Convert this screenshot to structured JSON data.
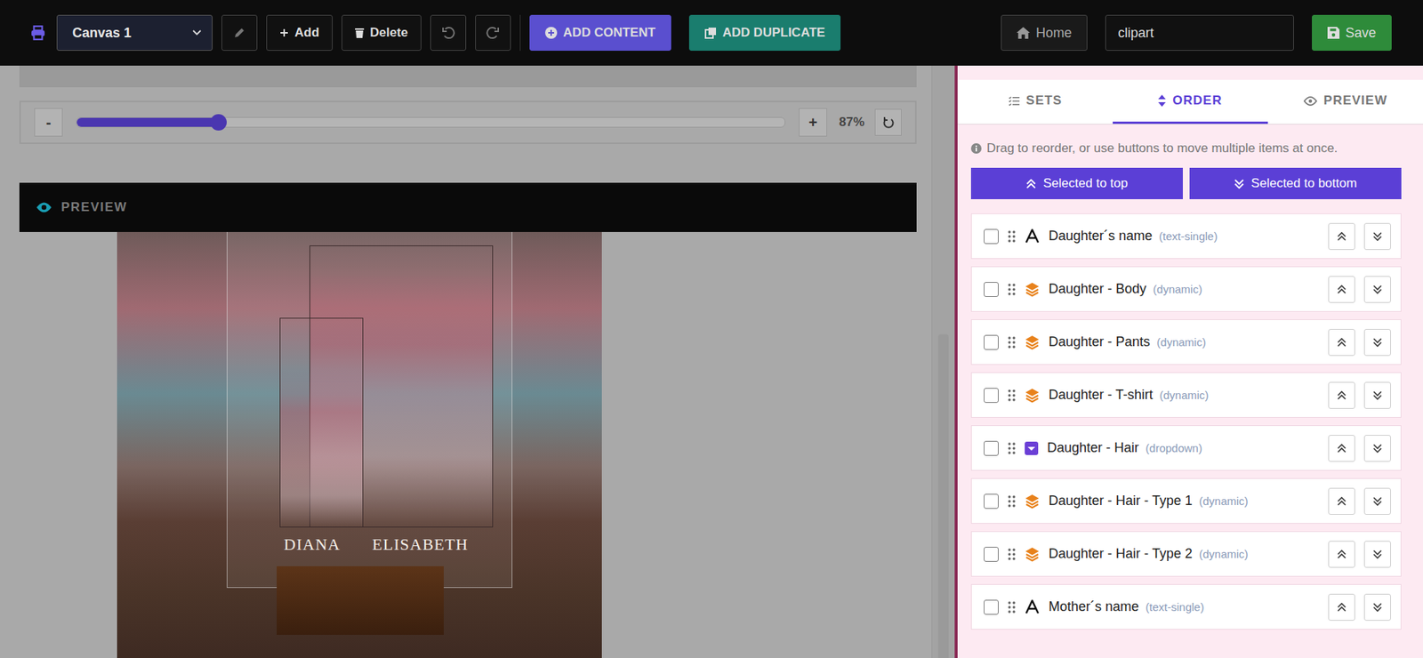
{
  "toolbar": {
    "canvas_select": "Canvas 1",
    "add": "Add",
    "delete": "Delete",
    "add_content": "ADD CONTENT",
    "add_duplicate": "ADD DUPLICATE",
    "home": "Home",
    "search_value": "clipart",
    "save": "Save"
  },
  "zoom": {
    "minus": "-",
    "plus": "+",
    "level": 0.2,
    "reading": "87%"
  },
  "preview": {
    "title": "PREVIEW",
    "names": [
      "DIANA",
      "ELISABETH"
    ]
  },
  "panel": {
    "tabs": [
      {
        "label": "SETS",
        "selected": false
      },
      {
        "label": "ORDER",
        "selected": true
      },
      {
        "label": "PREVIEW",
        "selected": false
      }
    ],
    "hint": "Drag to reorder, or use buttons to move multiple items at once.",
    "buttons": [
      "Selected to top",
      "Selected to bottom"
    ],
    "items": [
      {
        "name": "Daughter´s name",
        "type": "(text-single)",
        "kind": "text",
        "checked": false
      },
      {
        "name": "Daughter - Body",
        "type": "(dynamic)",
        "kind": "dynamic",
        "checked": false
      },
      {
        "name": "Daughter - Pants",
        "type": "(dynamic)",
        "kind": "dynamic",
        "checked": false
      },
      {
        "name": "Daughter - T-shirt",
        "type": "(dynamic)",
        "kind": "dynamic",
        "checked": false
      },
      {
        "name": "Daughter - Hair",
        "type": "(dropdown)",
        "kind": "dropdown",
        "checked": false
      },
      {
        "name": "Daughter - Hair - Type 1",
        "type": "(dynamic)",
        "kind": "dynamic",
        "checked": false
      },
      {
        "name": "Daughter - Hair - Type 2",
        "type": "(dynamic)",
        "kind": "dynamic",
        "checked": false
      },
      {
        "name": "Mother´s name",
        "type": "(text-single)",
        "kind": "text",
        "checked": false
      }
    ]
  }
}
